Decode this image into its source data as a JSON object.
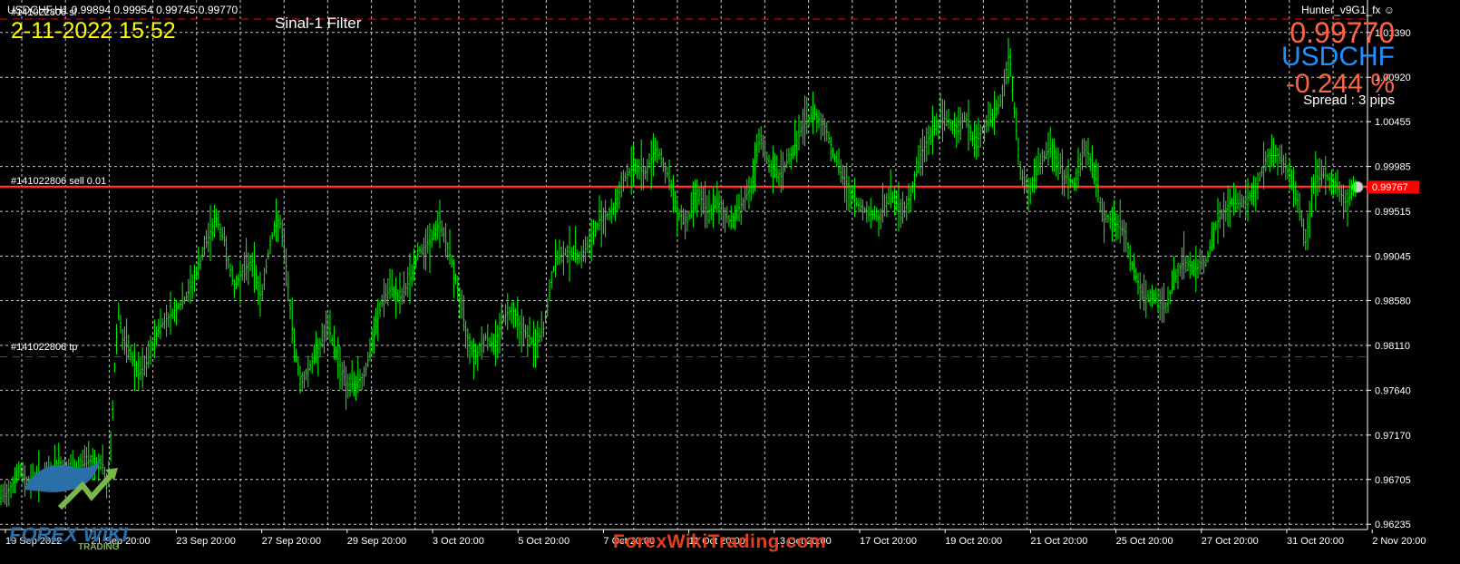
{
  "header": {
    "symbol_line": "USDCHF,H1  0.99894 0.99954 0.99745 0.99770",
    "datetime": "2-11-2022 15:52",
    "indicator": "Sinal-1 Filter",
    "expert": "Hunter_v9G1_fx ☺"
  },
  "info_panel": {
    "price": "0.99770",
    "symbol": "USDCHF",
    "change": "-0.244 %",
    "spread": "Spread : 3 pips",
    "price_color": "#ff6347",
    "symbol_color": "#1e90ff",
    "change_color": "#ff6347"
  },
  "orders": {
    "sell_label": "#141022806 sell 0.01",
    "tp_label": "#141022806 tp",
    "sl_label": "#141022806 sl"
  },
  "chart_data": {
    "type": "bar",
    "symbol": "USDCHF",
    "timeframe": "H1",
    "ylim": [
      0.9618,
      1.0173
    ],
    "y_ticks": [
      "1.01390",
      "1.00920",
      "1.00455",
      "0.99985",
      "0.99515",
      "0.99045",
      "0.98580",
      "0.98110",
      "0.97640",
      "0.97170",
      "0.96705",
      "0.96235"
    ],
    "x_ticks": [
      "19 Sep 2022",
      "21 Sep 20:00",
      "23 Sep 20:00",
      "27 Sep 20:00",
      "29 Sep 20:00",
      "3 Oct 20:00",
      "5 Oct 20:00",
      "7 Oct 20:00",
      "11 Oct 20:00",
      "13 Oct 20:00",
      "17 Oct 20:00",
      "19 Oct 20:00",
      "21 Oct 20:00",
      "25 Oct 20:00",
      "27 Oct 20:00",
      "31 Oct 20:00",
      "2 Nov 20:00"
    ],
    "bid_line": 0.9977,
    "bid_label": "0.99767",
    "sl_level": 1.0153,
    "tp_level": 0.9799,
    "grid": true,
    "bar_color": "#00ff00",
    "keypoints": [
      [
        0,
        0.965
      ],
      [
        10,
        0.966
      ],
      [
        22,
        0.968
      ],
      [
        30,
        0.9668
      ],
      [
        40,
        0.9672
      ],
      [
        50,
        0.9674
      ],
      [
        57,
        0.968
      ],
      [
        65,
        0.969
      ],
      [
        75,
        0.968
      ],
      [
        85,
        0.9683
      ],
      [
        100,
        0.969
      ],
      [
        113,
        0.9687
      ],
      [
        118,
        0.966
      ],
      [
        122,
        0.97
      ],
      [
        127,
        0.98
      ],
      [
        131,
        0.985
      ],
      [
        135,
        0.9818
      ],
      [
        145,
        0.98
      ],
      [
        152,
        0.978
      ],
      [
        160,
        0.9788
      ],
      [
        175,
        0.983
      ],
      [
        190,
        0.9845
      ],
      [
        205,
        0.986
      ],
      [
        218,
        0.989
      ],
      [
        228,
        0.992
      ],
      [
        238,
        0.9945
      ],
      [
        248,
        0.992
      ],
      [
        258,
        0.987
      ],
      [
        268,
        0.989
      ],
      [
        278,
        0.99
      ],
      [
        288,
        0.986
      ],
      [
        298,
        0.992
      ],
      [
        308,
        0.9945
      ],
      [
        315,
        0.99
      ],
      [
        322,
        0.983
      ],
      [
        332,
        0.977
      ],
      [
        342,
        0.979
      ],
      [
        352,
        0.981
      ],
      [
        362,
        0.983
      ],
      [
        372,
        0.98
      ],
      [
        382,
        0.977
      ],
      [
        392,
        0.977
      ],
      [
        402,
        0.978
      ],
      [
        412,
        0.982
      ],
      [
        422,
        0.986
      ],
      [
        432,
        0.987
      ],
      [
        442,
        0.986
      ],
      [
        452,
        0.988
      ],
      [
        462,
        0.991
      ],
      [
        475,
        0.992
      ],
      [
        485,
        0.994
      ],
      [
        495,
        0.991
      ],
      [
        505,
        0.987
      ],
      [
        515,
        0.982
      ],
      [
        525,
        0.98
      ],
      [
        535,
        0.982
      ],
      [
        545,
        0.981
      ],
      [
        555,
        0.984
      ],
      [
        565,
        0.985
      ],
      [
        575,
        0.983
      ],
      [
        590,
        0.981
      ],
      [
        600,
        0.983
      ],
      [
        612,
        0.99
      ],
      [
        625,
        0.991
      ],
      [
        640,
        0.9905
      ],
      [
        652,
        0.992
      ],
      [
        662,
        0.9945
      ],
      [
        675,
        0.995
      ],
      [
        688,
        0.9985
      ],
      [
        700,
        1.0
      ],
      [
        712,
        0.9992
      ],
      [
        724,
        1.002
      ],
      [
        736,
        0.999
      ],
      [
        748,
        0.995
      ],
      [
        758,
        0.994
      ],
      [
        768,
        0.9975
      ],
      [
        780,
        0.995
      ],
      [
        792,
        0.996
      ],
      [
        805,
        0.994
      ],
      [
        818,
        0.996
      ],
      [
        830,
        0.998
      ],
      [
        838,
        1.003
      ],
      [
        848,
        1.0
      ],
      [
        860,
        0.999
      ],
      [
        872,
        1.001
      ],
      [
        885,
        1.004
      ],
      [
        897,
        1.0055
      ],
      [
        910,
        1.004
      ],
      [
        920,
        1.001
      ],
      [
        932,
        0.998
      ],
      [
        945,
        0.996
      ],
      [
        958,
        0.995
      ],
      [
        970,
        0.9945
      ],
      [
        982,
        0.997
      ],
      [
        995,
        0.995
      ],
      [
        1005,
        0.997
      ],
      [
        1015,
        1.001
      ],
      [
        1025,
        1.003
      ],
      [
        1040,
        1.005
      ],
      [
        1055,
        1.004
      ],
      [
        1065,
        1.005
      ],
      [
        1075,
        1.002
      ],
      [
        1085,
        1.004
      ],
      [
        1095,
        1.005
      ],
      [
        1105,
        1.007
      ],
      [
        1113,
        1.012
      ],
      [
        1118,
        1.006
      ],
      [
        1126,
        0.999
      ],
      [
        1136,
        0.997
      ],
      [
        1146,
        1.0
      ],
      [
        1160,
        1.002
      ],
      [
        1172,
        0.999
      ],
      [
        1185,
        0.998
      ],
      [
        1197,
        1.002
      ],
      [
        1208,
        0.999
      ],
      [
        1215,
        0.995
      ],
      [
        1228,
        0.994
      ],
      [
        1240,
        0.993
      ],
      [
        1250,
        0.989
      ],
      [
        1262,
        0.986
      ],
      [
        1275,
        0.986
      ],
      [
        1285,
        0.985
      ],
      [
        1295,
        0.988
      ],
      [
        1305,
        0.99
      ],
      [
        1318,
        0.989
      ],
      [
        1330,
        0.99
      ],
      [
        1342,
        0.994
      ],
      [
        1356,
        0.996
      ],
      [
        1370,
        0.996
      ],
      [
        1385,
        0.9975
      ],
      [
        1398,
        1.001
      ],
      [
        1410,
        1.001
      ],
      [
        1422,
        0.999
      ],
      [
        1432,
        0.996
      ],
      [
        1440,
        0.992
      ],
      [
        1448,
        0.998
      ],
      [
        1460,
        0.999
      ],
      [
        1472,
        0.998
      ],
      [
        1485,
        0.996
      ],
      [
        1494,
        0.9977
      ]
    ]
  },
  "watermark": {
    "text": "ForexWikiTrading.com",
    "logo_text": "FOREX WIKI",
    "logo_sub": "TRADING"
  }
}
